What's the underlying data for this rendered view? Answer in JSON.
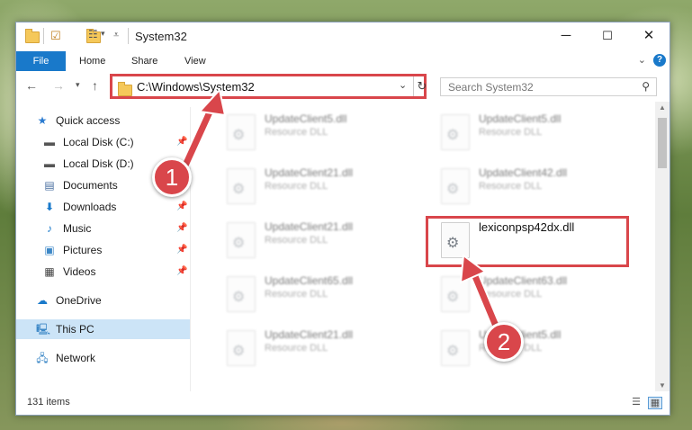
{
  "window": {
    "title": "System32"
  },
  "ribbon": {
    "tabs": [
      "File",
      "Home",
      "Share",
      "View"
    ],
    "help": "?"
  },
  "address": {
    "path": "C:\\Windows\\System32"
  },
  "search": {
    "placeholder": "Search System32"
  },
  "sidebar": {
    "items": [
      {
        "label": "Quick access",
        "icon": "star-icon"
      },
      {
        "label": "Local Disk (C:)",
        "icon": "drive-icon",
        "pinned": true
      },
      {
        "label": "Local Disk (D:)",
        "icon": "drive-icon"
      },
      {
        "label": "Documents",
        "icon": "document-icon",
        "pinned": true
      },
      {
        "label": "Downloads",
        "icon": "download-icon",
        "pinned": true
      },
      {
        "label": "Music",
        "icon": "music-icon",
        "pinned": true
      },
      {
        "label": "Pictures",
        "icon": "pictures-icon",
        "pinned": true
      },
      {
        "label": "Videos",
        "icon": "video-icon",
        "pinned": true
      },
      {
        "label": "OneDrive",
        "icon": "cloud-icon"
      },
      {
        "label": "This PC",
        "icon": "computer-icon",
        "selected": true
      },
      {
        "label": "Network",
        "icon": "network-icon"
      }
    ]
  },
  "files": [
    {
      "name": "UpdateClient5.dll",
      "type": "Resource DLL"
    },
    {
      "name": "UpdateClient5.dll",
      "type": "Resource DLL"
    },
    {
      "name": "UpdateClient21.dll",
      "type": "Resource DLL"
    },
    {
      "name": "UpdateClient42.dll",
      "type": "Resource DLL"
    },
    {
      "name": "UpdateClient21.dll",
      "type": "Resource DLL"
    },
    {
      "name": "lexiconpsp42dx.dll",
      "type": ""
    },
    {
      "name": "UpdateClient65.dll",
      "type": "Resource DLL"
    },
    {
      "name": "UpdateClient63.dll",
      "type": "Resource DLL"
    },
    {
      "name": "UpdateClient21.dll",
      "type": "Resource DLL"
    },
    {
      "name": "UpdateClient5.dll",
      "type": "Resource DLL"
    }
  ],
  "status": {
    "count": "131 items"
  },
  "callouts": {
    "one": "1",
    "two": "2"
  },
  "colors": {
    "accent": "#1979ca",
    "highlight": "#d9464b",
    "selected": "#cce4f7"
  }
}
